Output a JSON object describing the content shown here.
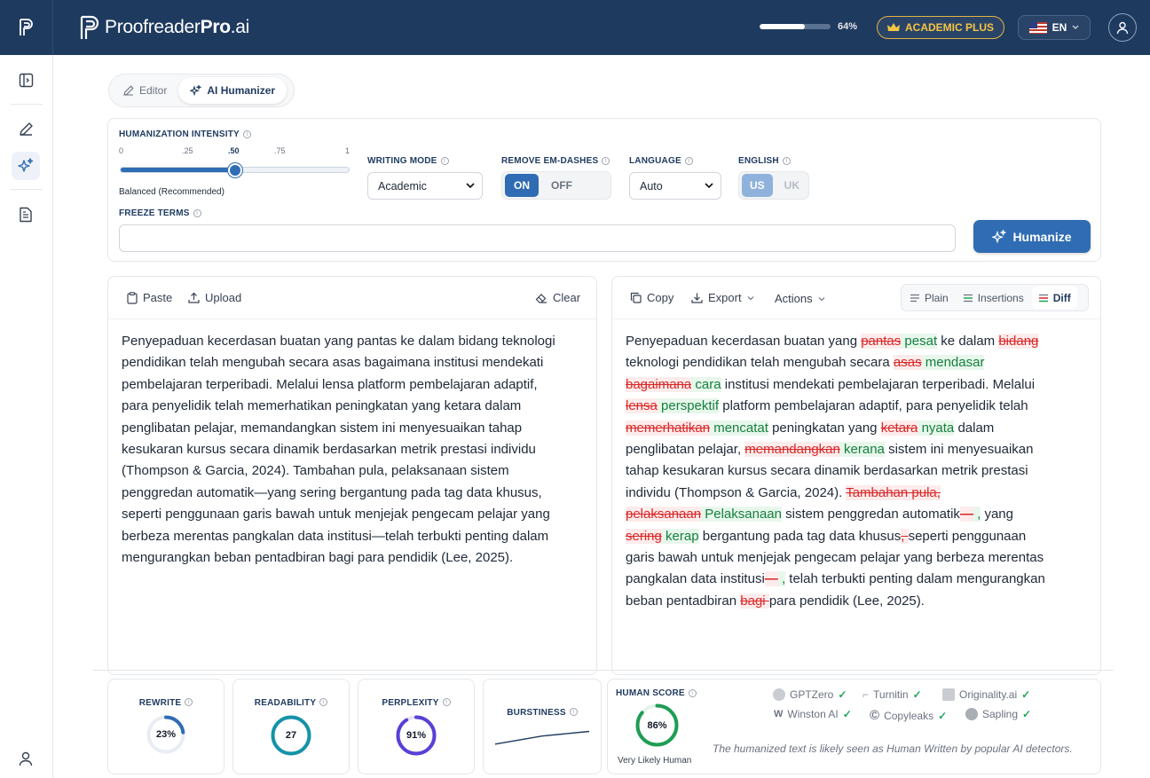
{
  "header": {
    "brand_main": "Proofreader",
    "brand_bold": "Pro",
    "brand_suffix": ".ai",
    "usage_percent": 64,
    "usage_label": "64%",
    "plan_label": "ACADEMIC PLUS",
    "language": "EN",
    "colors": {
      "bar": "#1e3a5f",
      "accent": "#2f6cb3",
      "plan": "#f5c542"
    }
  },
  "sidebar": {
    "items": [
      {
        "icon": "panel-toggle-icon"
      },
      {
        "icon": "pencil-icon"
      },
      {
        "icon": "sparkle-icon",
        "active": true
      },
      {
        "icon": "document-icon"
      },
      {
        "icon": "user-icon"
      }
    ]
  },
  "tabs": [
    {
      "label": "Editor",
      "icon": "pencil-icon"
    },
    {
      "label": "AI Humanizer",
      "icon": "sparkle-icon",
      "active": true
    }
  ],
  "settings": {
    "intensity": {
      "label": "HUMANIZATION INTENSITY",
      "ticks": [
        "0",
        ".25",
        ".50",
        ".75",
        "1"
      ],
      "value": 0.5,
      "caption": "Balanced (Recommended)"
    },
    "writing_mode": {
      "label": "WRITING MODE",
      "value": "Academic"
    },
    "em_dashes": {
      "label": "REMOVE EM-DASHES",
      "on": "ON",
      "off": "OFF",
      "selected": "ON"
    },
    "language": {
      "label": "LANGUAGE",
      "value": "Auto"
    },
    "english": {
      "label": "ENGLISH",
      "us": "US",
      "uk": "UK",
      "selected": "US"
    },
    "freeze": {
      "label": "FREEZE TERMS",
      "value": ""
    },
    "humanize_button": "Humanize"
  },
  "input_panel": {
    "paste": "Paste",
    "upload": "Upload",
    "clear": "Clear",
    "lines": [
      "Penyepaduan kecerdasan buatan yang pantas ke dalam bidang teknologi",
      "pendidikan telah mengubah secara asas bagaimana institusi mendekati",
      "pembelajaran terperibadi. Melalui lensa platform pembelajaran adaptif,",
      "para penyelidik telah memerhatikan peningkatan yang ketara dalam",
      "penglibatan pelajar, memandangkan sistem ini menyesuaikan tahap",
      "kesukaran kursus secara dinamik berdasarkan metrik prestasi individu",
      "(Thompson & Garcia, 2024). Tambahan pula, pelaksanaan sistem",
      "penggredan automatik—yang sering bergantung pada tag data khusus,",
      "seperti penggunaan garis bawah untuk menjejak pengecam pelajar yang",
      "berbeza merentas pangkalan data institusi—telah terbukti penting dalam",
      "mengurangkan beban pentadbiran bagi para pendidik (Lee, 2025)."
    ]
  },
  "output_panel": {
    "copy": "Copy",
    "export": "Export",
    "actions": "Actions",
    "modes": [
      "Plain",
      "Insertions",
      "Diff"
    ],
    "active_mode": "Diff",
    "lines": [
      [
        {
          "t": "Penyepaduan kecerdasan buatan yang "
        },
        {
          "d": "pantas"
        },
        {
          "i": " pesat"
        },
        {
          "t": " ke dalam "
        },
        {
          "d": "bidang "
        }
      ],
      [
        {
          "t": "teknologi pendidikan telah mengubah secara "
        },
        {
          "d": "asas"
        },
        {
          "i": " mendasar "
        }
      ],
      [
        {
          "d": "bagaimana"
        },
        {
          "i": " cara"
        },
        {
          "t": " institusi mendekati pembelajaran terperibadi. Melalui"
        }
      ],
      [
        {
          "d": "lensa"
        },
        {
          "i": " perspektif"
        },
        {
          "t": " platform pembelajaran adaptif, para penyelidik telah"
        }
      ],
      [
        {
          "d": "memerhatikan"
        },
        {
          "i": " mencatat"
        },
        {
          "t": " peningkatan yang "
        },
        {
          "d": "ketara"
        },
        {
          "i": " nyata"
        },
        {
          "t": " dalam"
        }
      ],
      [
        {
          "t": "penglibatan pelajar, "
        },
        {
          "d": "memandangkan"
        },
        {
          "i": " kerana"
        },
        {
          "t": " sistem ini menyesuaikan"
        }
      ],
      [
        {
          "t": "tahap kesukaran kursus secara dinamik berdasarkan metrik prestasi"
        }
      ],
      [
        {
          "t": "individu (Thompson & Garcia, 2024). "
        },
        {
          "d": "Tambahan pula,"
        }
      ],
      [
        {
          "d": "pelaksanaan"
        },
        {
          "i": " Pelaksanaan"
        },
        {
          "t": " sistem penggredan automatik"
        },
        {
          "d": "—"
        },
        {
          "i": " ,"
        },
        {
          "t": " yang"
        }
      ],
      [
        {
          "d": "sering"
        },
        {
          "i": " kerap"
        },
        {
          "t": " bergantung pada tag data khusus"
        },
        {
          "d": ", "
        },
        {
          "t": "seperti penggunaan"
        }
      ],
      [
        {
          "t": "garis bawah untuk menjejak pengecam pelajar yang berbeza merentas"
        }
      ],
      [
        {
          "t": "pangkalan data institusi"
        },
        {
          "d": "—"
        },
        {
          "i": " ,"
        },
        {
          "t": " telah terbukti penting dalam mengurangkan"
        }
      ],
      [
        {
          "t": "beban pentadbiran "
        },
        {
          "d": "bagi "
        },
        {
          "t": "para pendidik (Lee, 2025)."
        }
      ]
    ]
  },
  "metrics": {
    "rewrite": {
      "label": "REWRITE",
      "value": 23,
      "display": "23%",
      "color": "#2f6cb3"
    },
    "readability": {
      "label": "READABILITY",
      "value": 27,
      "display": "27",
      "color": "#1592a8"
    },
    "perplexity": {
      "label": "PERPLEXITY",
      "value": 91,
      "display": "91%",
      "color": "#5a3fd6"
    },
    "burstiness": {
      "label": "BURSTINESS",
      "series": [
        0.2,
        0.55,
        0.75
      ]
    },
    "human_score": {
      "label": "HUMAN SCORE",
      "value": 86,
      "display": "86%",
      "caption": "Very Likely Human",
      "color": "#1f9d55"
    }
  },
  "detectors": [
    {
      "name": "GPTZero",
      "icon": "gptzero-icon"
    },
    {
      "name": "Turnitin",
      "icon": "turnitin-icon"
    },
    {
      "name": "Originality.ai",
      "icon": "originality-icon"
    },
    {
      "name": "Winston AI",
      "icon": "winston-icon"
    },
    {
      "name": "Copyleaks",
      "icon": "copyleaks-icon"
    },
    {
      "name": "Sapling",
      "icon": "sapling-icon"
    }
  ],
  "detector_note": "The humanized text is likely seen as Human Written by popular AI detectors."
}
